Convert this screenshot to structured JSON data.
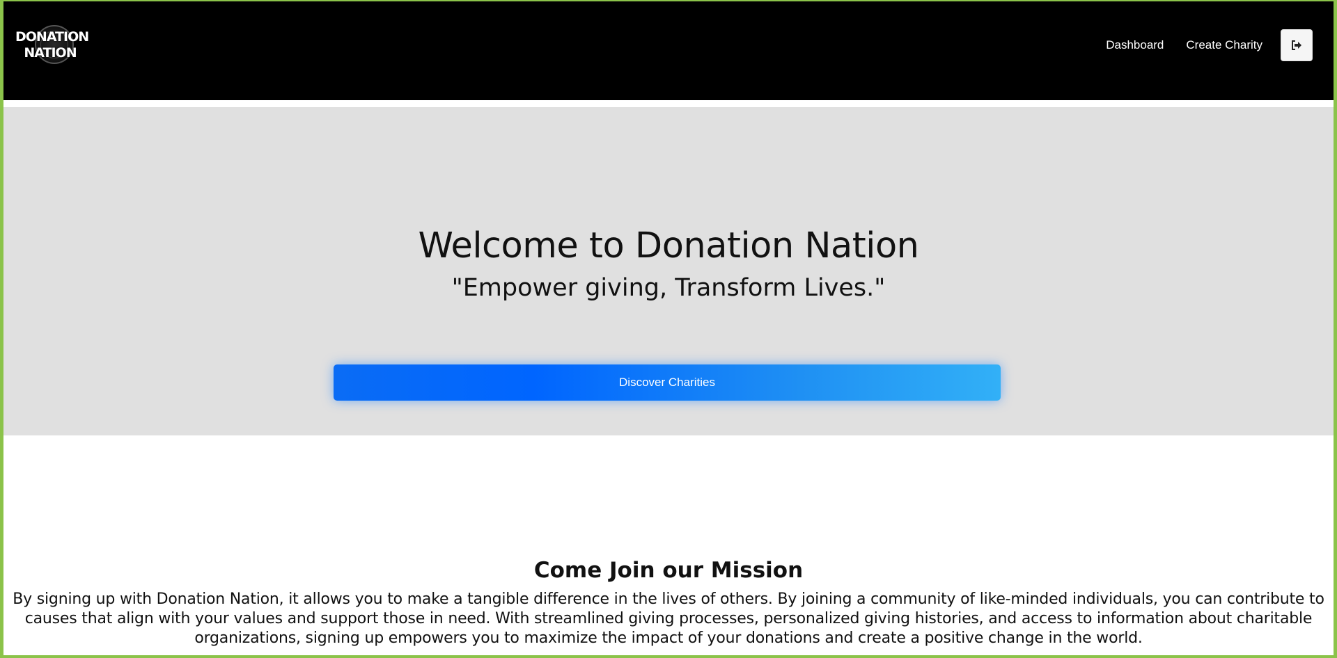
{
  "header": {
    "logo_line1": "DONATION",
    "logo_line2": "NATION",
    "nav": {
      "dashboard": "Dashboard",
      "create_charity": "Create Charity"
    },
    "logout_icon": "sign-out-icon"
  },
  "hero": {
    "title": "Welcome to Donation Nation",
    "tagline": "\"Empower giving, Transform Lives.\"",
    "cta_label": "Discover Charities"
  },
  "mission": {
    "title": "Come Join our Mission",
    "body": "By signing up with Donation Nation, it allows you to make a tangible difference in the lives of others. By joining a community of like-minded individuals, you can contribute to causes that align with your values and support those in need. With streamlined giving processes, personalized giving histories, and access to information about charitable organizations, signing up empowers you to maximize the impact of your donations and create a positive change in the world."
  },
  "colors": {
    "page_border": "#8bc34a",
    "header_bg": "#000000",
    "hero_bg": "#e0e0e0",
    "cta_start": "#0065ff",
    "cta_end": "#32b0f7"
  }
}
